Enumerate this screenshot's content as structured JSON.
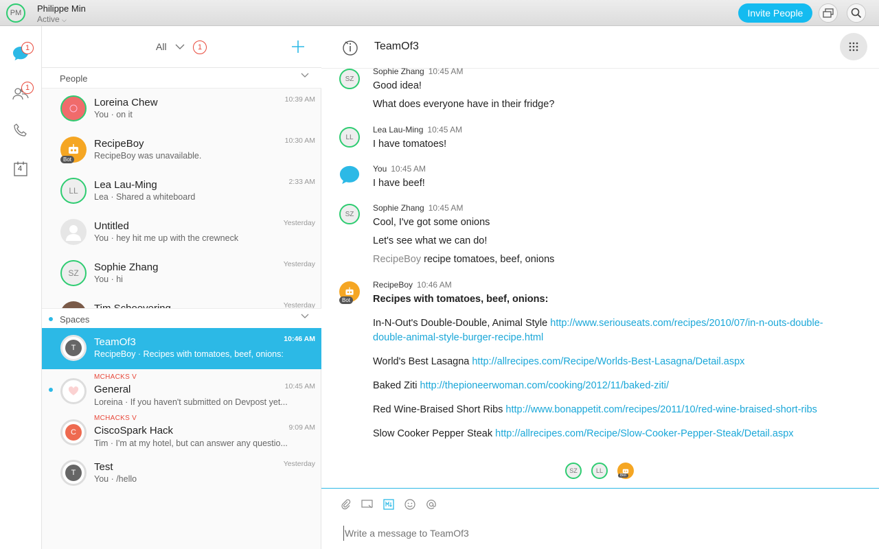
{
  "user": {
    "initials": "PM",
    "name": "Philippe Min",
    "status": "Active"
  },
  "header": {
    "invite_label": "Invite People"
  },
  "rail": {
    "messages_badge": "1",
    "teams_badge": "1",
    "calendar_day": "4"
  },
  "list": {
    "filter_label": "All",
    "filter_badge": "1",
    "people_section": "People",
    "spaces_section": "Spaces",
    "people": [
      {
        "name": "Loreina Chew",
        "sub": "You · on it",
        "time": "10:39 AM"
      },
      {
        "name": "RecipeBoy",
        "sub": "RecipeBoy was unavailable.",
        "time": "10:30 AM",
        "bot": "Bot"
      },
      {
        "name": "Lea Lau-Ming",
        "sub": "Lea · Shared a whiteboard",
        "time": "2:33 AM",
        "initials": "LL"
      },
      {
        "name": "Untitled",
        "sub": "You · hey hit me up with the crewneck",
        "time": "Yesterday"
      },
      {
        "name": "Sophie Zhang",
        "sub": "You · hi",
        "time": "Yesterday",
        "initials": "SZ"
      },
      {
        "name": "Tim Schoevering",
        "time": "Yesterday"
      }
    ],
    "spaces": [
      {
        "name": "TeamOf3",
        "sub": "RecipeBoy · Recipes with tomatoes, beef, onions:",
        "time": "10:46 AM",
        "initials": "T"
      },
      {
        "tag": "MCHACKS V",
        "name": "General",
        "sub": "Loreina · If you haven't submitted on Devpost yet...",
        "time": "10:45 AM"
      },
      {
        "tag": "MCHACKS V",
        "name": "CiscoSpark Hack",
        "sub": "Tim · I'm at my hotel, but can answer any questio...",
        "time": "9:09 AM",
        "initials": "C"
      },
      {
        "name": "Test",
        "sub": "You · /hello",
        "time": "Yesterday",
        "initials": "T"
      }
    ]
  },
  "conversation": {
    "title": "TeamOf3",
    "messages": [
      {
        "sender": "Sophie Zhang",
        "time": "10:45 AM",
        "initials": "SZ",
        "lines": [
          "Good idea!",
          "What does everyone have in their fridge?"
        ]
      },
      {
        "sender": "Lea Lau-Ming",
        "time": "10:45 AM",
        "initials": "LL",
        "lines": [
          "I have tomatoes!"
        ]
      },
      {
        "sender": "You",
        "time": "10:45 AM",
        "lines": [
          "I have beef!"
        ]
      },
      {
        "sender": "Sophie Zhang",
        "time": "10:45 AM",
        "initials": "SZ",
        "lines": [
          "Cool, I've got some onions",
          "Let's see what we can do!"
        ],
        "mention": "RecipeBoy",
        "mention_rest": " recipe tomatoes, beef, onions"
      },
      {
        "sender": "RecipeBoy",
        "time": "10:46 AM",
        "bot": "Bot",
        "heading": "Recipes with tomatoes, beef, onions:"
      }
    ],
    "recipes": [
      {
        "name": "In-N-Out's Double-Double, Animal Style",
        "url1": "http://www.seriouseats.com/recipes/2010/07/in-n-outs-double-",
        "url2": "double-animal-style-burger-recipe.html"
      },
      {
        "name": "World's Best Lasagna",
        "url1": "http://allrecipes.com/Recipe/Worlds-Best-Lasagna/Detail.aspx"
      },
      {
        "name": "Baked Ziti",
        "url1": "http://thepioneerwoman.com/cooking/2012/11/baked-ziti/"
      },
      {
        "name": "Red Wine-Braised Short Ribs",
        "url1": "http://www.bonappetit.com/recipes/2011/10/red-wine-braised-short-ribs"
      },
      {
        "name": "Slow Cooker Pepper Steak",
        "url1": "http://allrecipes.com/Recipe/Slow-Cooker-Pepper-Steak/Detail.aspx"
      }
    ],
    "read_receipts": [
      "SZ",
      "LL",
      "Bot"
    ],
    "composer_placeholder": "Write a message to TeamOf3"
  },
  "colors": {
    "accent": "#2cb9e6",
    "presence": "#2ecc71",
    "badge": "#e8483a",
    "bot_avatar": "#f5a623"
  }
}
